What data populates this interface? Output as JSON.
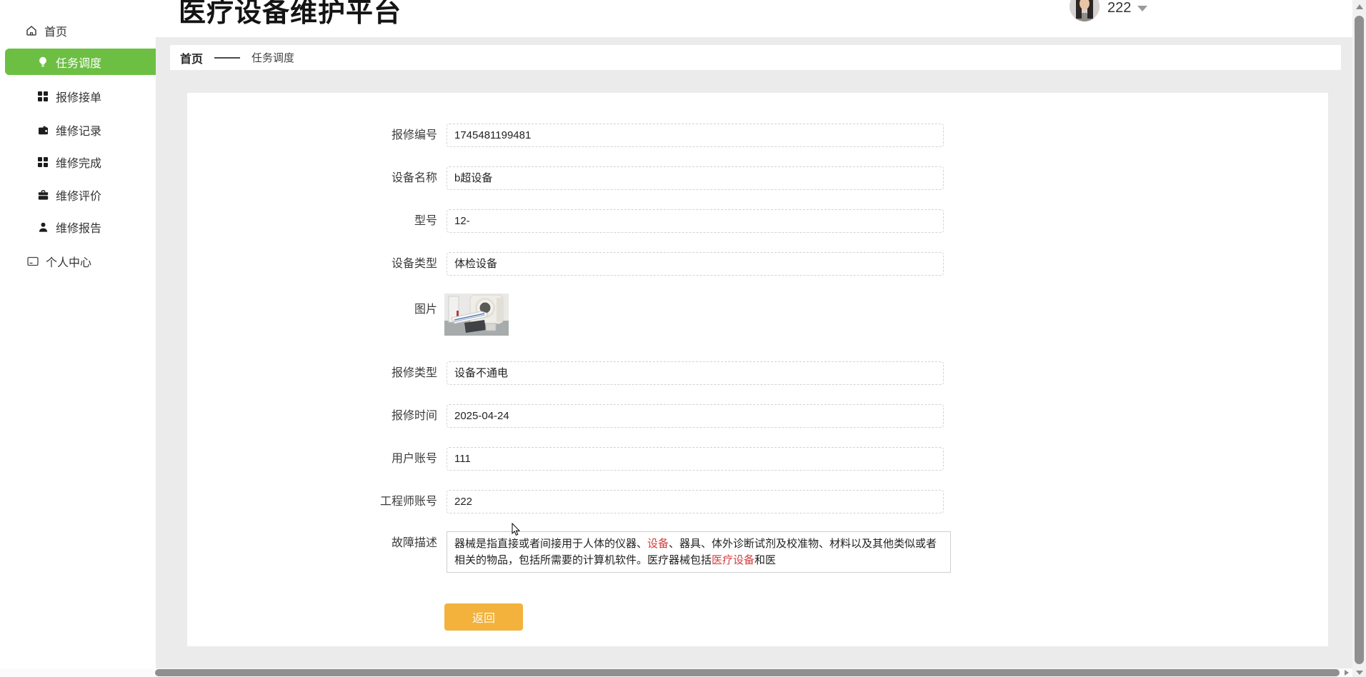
{
  "colors": {
    "accent_green": "#6cbf43",
    "button_orange": "#f2b23c",
    "link_red": "#d43c3c",
    "content_bg": "#ebebeb",
    "scrollbar_thumb": "#8f8f8f"
  },
  "header": {
    "title": "医疗设备维护平台",
    "username": "222"
  },
  "sidebar": {
    "items": [
      {
        "label": "首页",
        "icon": "home-icon",
        "active": false
      },
      {
        "label": "任务调度",
        "icon": "bulb-icon",
        "active": true
      },
      {
        "label": "报修接单",
        "icon": "grid-icon",
        "active": false
      },
      {
        "label": "维修记录",
        "icon": "wallet-icon",
        "active": false
      },
      {
        "label": "维修完成",
        "icon": "grid-icon",
        "active": false
      },
      {
        "label": "维修评价",
        "icon": "briefcase-icon",
        "active": false
      },
      {
        "label": "维修报告",
        "icon": "person-icon",
        "active": false
      },
      {
        "label": "个人中心",
        "icon": "card-icon",
        "active": false
      }
    ]
  },
  "breadcrumb": {
    "home": "首页",
    "current": "任务调度"
  },
  "form": {
    "fields": [
      {
        "label": "报修编号",
        "value": "1745481199481"
      },
      {
        "label": "设备名称",
        "value": "b超设备"
      },
      {
        "label": "型号",
        "value": "12-"
      },
      {
        "label": "设备类型",
        "value": "体检设备"
      },
      {
        "label": "图片",
        "value": ""
      },
      {
        "label": "报修类型",
        "value": "设备不通电"
      },
      {
        "label": "报修时间",
        "value": "2025-04-24"
      },
      {
        "label": "用户账号",
        "value": "111"
      },
      {
        "label": "工程师账号",
        "value": "222"
      }
    ],
    "description": {
      "label": "故障描述",
      "segments": [
        {
          "text": "器械是指直接或者间接用于人体的仪器、",
          "red": false
        },
        {
          "text": "设备",
          "red": true
        },
        {
          "text": "、器具、体外诊断试剂及校准物、材料以及其他类似或者相关的物品，包括所需要的计算机软件。医疗器械包括",
          "red": false
        },
        {
          "text": "医疗设备",
          "red": true
        },
        {
          "text": "和医",
          "red": false
        }
      ]
    },
    "back_button": "返回"
  }
}
